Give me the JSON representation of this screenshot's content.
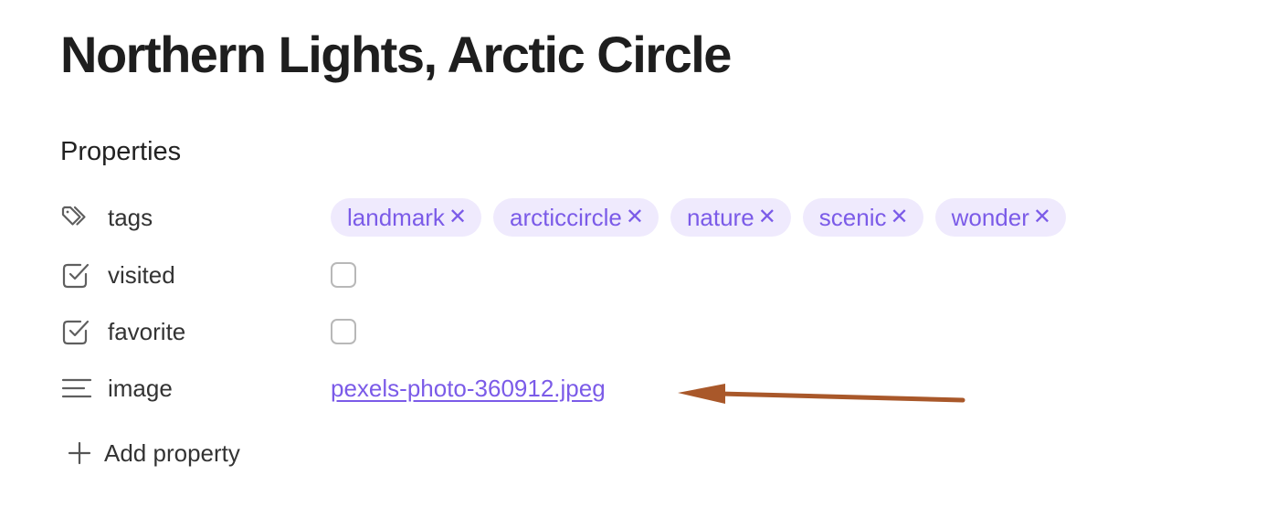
{
  "page": {
    "title": "Northern Lights, Arctic Circle"
  },
  "properties": {
    "heading": "Properties",
    "tags": {
      "name": "tags",
      "icon": "tags-icon",
      "values": [
        {
          "label": "landmark",
          "remove": "✕"
        },
        {
          "label": "arcticcircle",
          "remove": "✕"
        },
        {
          "label": "nature",
          "remove": "✕"
        },
        {
          "label": "scenic",
          "remove": "✕"
        },
        {
          "label": "wonder",
          "remove": "✕"
        }
      ]
    },
    "visited": {
      "name": "visited",
      "icon": "checkbox-property-icon",
      "checked": false
    },
    "favorite": {
      "name": "favorite",
      "icon": "checkbox-property-icon",
      "checked": false
    },
    "image": {
      "name": "image",
      "icon": "text-lines-icon",
      "value": "pexels-photo-360912.jpeg"
    },
    "add_label": "Add property"
  },
  "colors": {
    "tag_background": "#efeafd",
    "accent": "#7b5be8",
    "annotation_arrow": "#a9582a"
  }
}
